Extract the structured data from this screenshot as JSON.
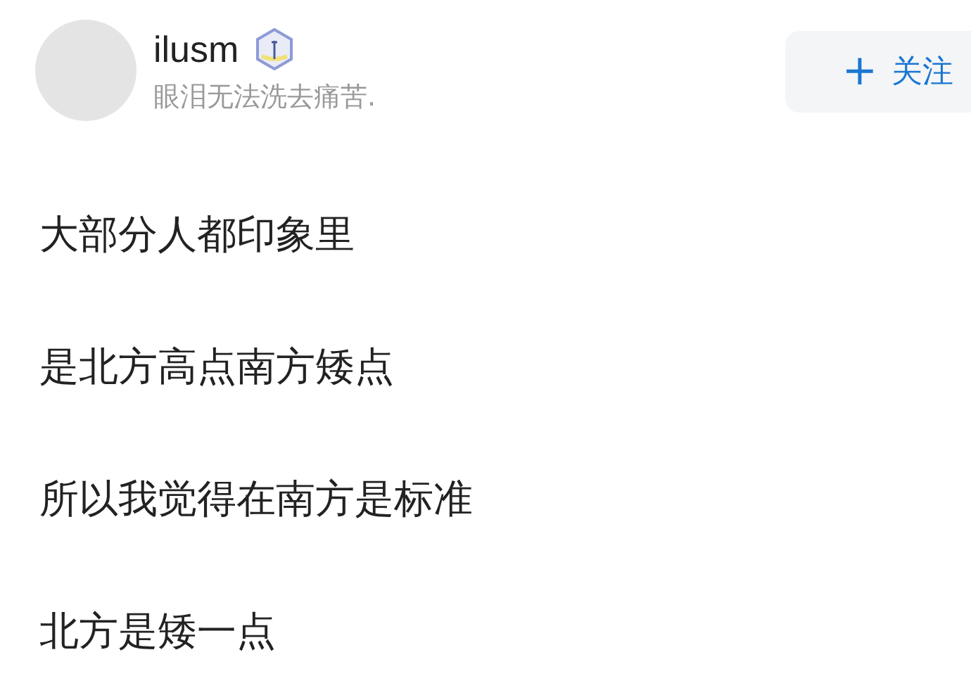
{
  "author": {
    "name": "ilusm",
    "bio": "眼泪无法洗去痛苦."
  },
  "follow_button": {
    "icon": "+",
    "label": "关注"
  },
  "post": {
    "lines": [
      "大部分人都印象里",
      "是北方高点南方矮点",
      "所以我觉得在南方是标准",
      "北方是矮一点"
    ]
  }
}
